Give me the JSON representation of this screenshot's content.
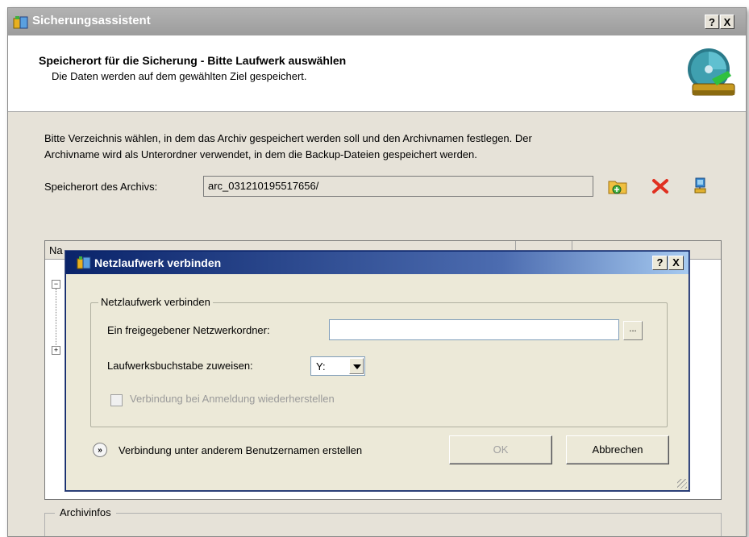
{
  "main_window": {
    "title": "Sicherungsassistent",
    "help_button": "?",
    "close_button": "X",
    "header": {
      "title": "Speicherort für die Sicherung - Bitte Laufwerk auswählen",
      "subtitle": "Die Daten werden auf dem gewählten Ziel gespeichert."
    },
    "description_line1": "Bitte Verzeichnis wählen, in dem das Archiv gespeichert werden soll und den Archivnamen festlegen. Der",
    "description_line2": "Archivname wird als Unterordner verwendet, in dem die Backup-Dateien gespeichert werden.",
    "storage_label": "Speicherort des Archivs:",
    "storage_value": "arc_031210195517656/",
    "list_header_name": "Na",
    "archive_info_legend": "Archivinfos"
  },
  "dialog": {
    "title": "Netzlaufwerk verbinden",
    "help_button": "?",
    "close_button": "X",
    "group_label": "Netzlaufwerk verbinden",
    "folder_label": "Ein freigegebener Netzwerkordner:",
    "folder_value": "",
    "browse_label": "...",
    "drive_label": "Laufwerksbuchstabe zuweisen:",
    "drive_value": "Y:",
    "reconnect_label": "Verbindung bei Anmeldung wiederherstellen",
    "reconnect_checked": false,
    "other_user_label": "Verbindung unter anderem Benutzernamen erstellen",
    "ok_label": "OK",
    "cancel_label": "Abbrechen"
  },
  "colors": {
    "dialog_title_start": "#0a246a",
    "dialog_title_end": "#a6caf0",
    "window_bg": "#e6e2d8",
    "delete_icon": "#e03020"
  },
  "icons": [
    "app-icon",
    "backup-drive-icon",
    "new-folder-icon",
    "delete-icon",
    "network-drive-icon",
    "expand-icon",
    "collapse-icon",
    "chevron-down-circle-icon",
    "resize-grip-icon"
  ]
}
